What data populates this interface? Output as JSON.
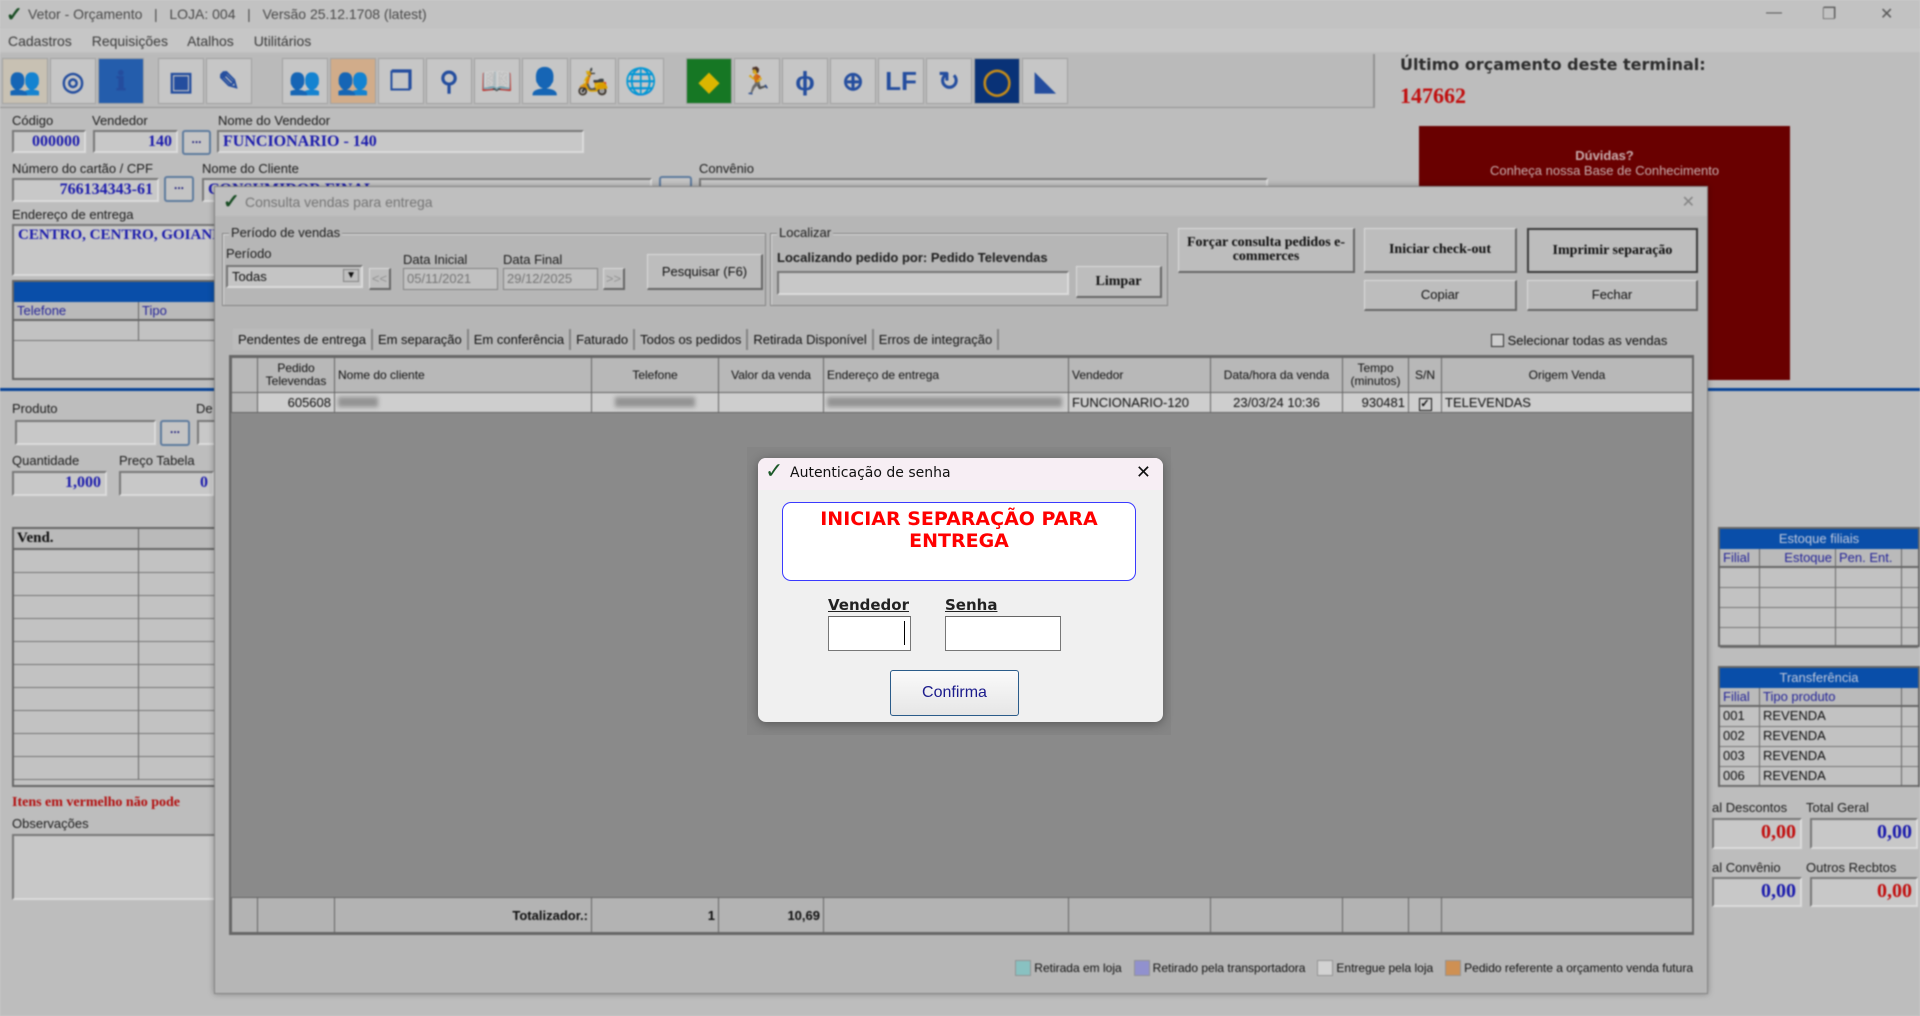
{
  "app": {
    "title": "Vetor - Orçamento   |   LOJA: 004   |   Versão 25.12.1708 (latest)"
  },
  "menu": [
    "Cadastros",
    "Requisições",
    "Atalhos",
    "Utilitários"
  ],
  "toolbar_icons": [
    "add-client-icon",
    "refresh-icon",
    "info-icon",
    "save-icon",
    "edit-icon",
    "clients-icon",
    "clients-selected-icon",
    "documents-icon",
    "search-icon",
    "book-icon",
    "user-icon",
    "delivery-icon",
    "web-store-icon",
    "brazil-flag-icon",
    "person-icon",
    "dna-icon",
    "plus-circle-icon",
    "lf-icon",
    "sync-icon",
    "ring-icon",
    "arrow-logo-icon"
  ],
  "form": {
    "codigo_label": "Código",
    "codigo": "000000",
    "vendedor_label": "Vendedor",
    "vendedor": "140",
    "nome_vendedor_label": "Nome do Vendedor",
    "nome_vendedor": "FUNCIONARIO - 140",
    "cpf_label": "Número do cartão / CPF",
    "cpf": "766134343-61",
    "nome_cliente_label": "Nome do Cliente",
    "nome_cliente": "CONSUMIDOR FINAL",
    "convenio_label": "Convênio",
    "endereco_label": "Endereço de entrega",
    "endereco": "CENTRO, CENTRO, GOIANI",
    "dots": "...",
    "telefones_title": "Telefones",
    "telefones_cols": [
      "Telefone",
      "Tipo"
    ],
    "produto_label": "Produto",
    "descricao_label": "De",
    "quantidade_label": "Quantidade",
    "quantidade": "1,000",
    "preco_label": "Preço Tabela",
    "preco": "0",
    "items_col": "Vend.",
    "warning": "Itens em vermelho não pode",
    "observacoes_label": "Observações"
  },
  "ultimo": {
    "label": "Último orçamento deste terminal:",
    "value": "147662"
  },
  "help_box": {
    "title": "Dúvidas?",
    "text": "Conheça nossa Base de Conhecimento"
  },
  "estoque": {
    "title": "Estoque filiais",
    "cols": [
      "Filial",
      "Estoque",
      "Pen. Ent."
    ]
  },
  "transferencia": {
    "title": "Transferência",
    "cols": [
      "Filial",
      "Tipo produto"
    ],
    "rows": [
      [
        "001",
        "REVENDA"
      ],
      [
        "002",
        "REVENDA"
      ],
      [
        "003",
        "REVENDA"
      ],
      [
        "006",
        "REVENDA"
      ]
    ]
  },
  "totals": {
    "descontos_label": "al Descontos",
    "descontos": "0,00",
    "geral_label": "Total Geral",
    "geral": "0,00",
    "convenio_label": "al Convênio",
    "convenio": "0,00",
    "outros_label": "Outros Recbtos",
    "outros": "0,00"
  },
  "consulta": {
    "title": "Consulta vendas para entrega",
    "periodo_group": "Período de vendas",
    "periodo_label": "Período",
    "periodo_value": "Todas",
    "data_inicial_label": "Data Inicial",
    "data_inicial": "05/11/2021",
    "data_final_label": "Data Final",
    "data_final": "29/12/2025",
    "prev": "<<",
    "next": ">>",
    "pesquisar": "Pesquisar (F6)",
    "localizar_group": "Localizar",
    "localizando": "Localizando pedido por: Pedido Televendas",
    "limpar": "Limpar",
    "forcar": "Forçar consulta pedidos e-commerces",
    "checkout": "Iniciar check-out",
    "imprimir": "Imprimir separação",
    "copiar": "Copiar",
    "fechar": "Fechar",
    "tabs": [
      "Pendentes de entrega",
      "Em separação",
      "Em conferência",
      "Faturado",
      "Todos os pedidos",
      "Retirada Disponível",
      "Erros de integração"
    ],
    "select_all": "Selecionar todas as vendas",
    "columns": [
      "",
      "Pedido Televendas",
      "Nome do cliente",
      "Telefone",
      "Valor da venda",
      "Endereço de entrega",
      "Vendedor",
      "Data/hora da venda",
      "Tempo (minutos)",
      "S/N",
      "Origem Venda"
    ],
    "row": {
      "pedido": "605608",
      "vendedor": "FUNCIONARIO-120",
      "data": "23/03/24 10:36",
      "tempo": "930481",
      "sn": true,
      "origem": "TELEVENDAS"
    },
    "totalizador_label": "Totalizador.:",
    "total_count": "1",
    "total_value": "10,69",
    "legend": [
      {
        "label": "Retirada em loja",
        "color": "#9fe0e0"
      },
      {
        "label": "Retirado pela transportadora",
        "color": "#a9a9f0"
      },
      {
        "label": "Entregue pela loja",
        "color": "#f4f4f4"
      },
      {
        "label": "Pedido referente a orçamento venda futura",
        "color": "#f0a860"
      }
    ]
  },
  "auth": {
    "title": "Autenticação de senha",
    "message": "INICIAR SEPARAÇÃO PARA ENTREGA",
    "vendedor_label": "Vendedor",
    "senha_label": "Senha",
    "confirma": "Confirma"
  },
  "colors": {
    "accent_blue": "#0a5bc4",
    "alert_red": "#ff0000",
    "help_box": "#7a0000"
  }
}
